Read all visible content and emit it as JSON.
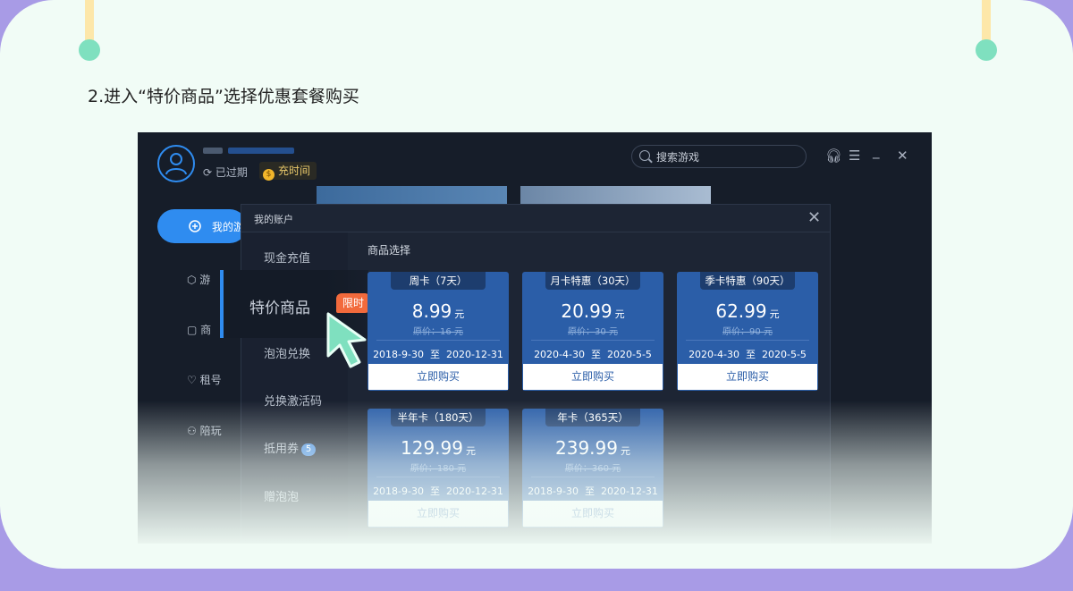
{
  "step_title": "2.进入“特价商品”选择优惠套餐购买",
  "header": {
    "status": "已过期",
    "recharge_label": "充时间",
    "search_placeholder": "搜索游戏"
  },
  "nav": {
    "active": "我的游",
    "items": [
      "游",
      "商",
      "租号",
      "陪玩"
    ]
  },
  "modal": {
    "title": "我的账户",
    "section_title": "商品选择",
    "sidebar": {
      "cash_recharge": "现金充值",
      "special": "特价商品",
      "limited_tag": "限时",
      "bubble_exchange": "泡泡兑换",
      "activation": "兑换激活码",
      "coupon": "抵用券",
      "coupon_count": "5",
      "gift": "赠泡泡"
    },
    "products": [
      {
        "name": "周卡（7天）",
        "price": "8.99",
        "unit": "元",
        "original": "原价：16 元",
        "start": "2018-9-30",
        "to": "至",
        "end": "2020-12-31",
        "buy": "立即购买"
      },
      {
        "name": "月卡特惠（30天）",
        "price": "20.99",
        "unit": "元",
        "original": "原价：30 元",
        "start": "2020-4-30",
        "to": "至",
        "end": "2020-5-5",
        "buy": "立即购买"
      },
      {
        "name": "季卡特惠（90天）",
        "price": "62.99",
        "unit": "元",
        "original": "原价：90 元",
        "start": "2020-4-30",
        "to": "至",
        "end": "2020-5-5",
        "buy": "立即购买"
      },
      {
        "name": "半年卡（180天）",
        "price": "129.99",
        "unit": "元",
        "original": "原价：180 元",
        "start": "2018-9-30",
        "to": "至",
        "end": "2020-12-31",
        "buy": "立即购买"
      },
      {
        "name": "年卡（365天）",
        "price": "239.99",
        "unit": "元",
        "original": "原价：360 元",
        "start": "2018-9-30",
        "to": "至",
        "end": "2020-12-31",
        "buy": "立即购买"
      }
    ]
  },
  "colors": {
    "accent": "#2f8cf0",
    "card": "#2b5ea8",
    "tag": "#f26a3c",
    "cursor": "#7fe0bf",
    "frame": "#a89be6"
  }
}
